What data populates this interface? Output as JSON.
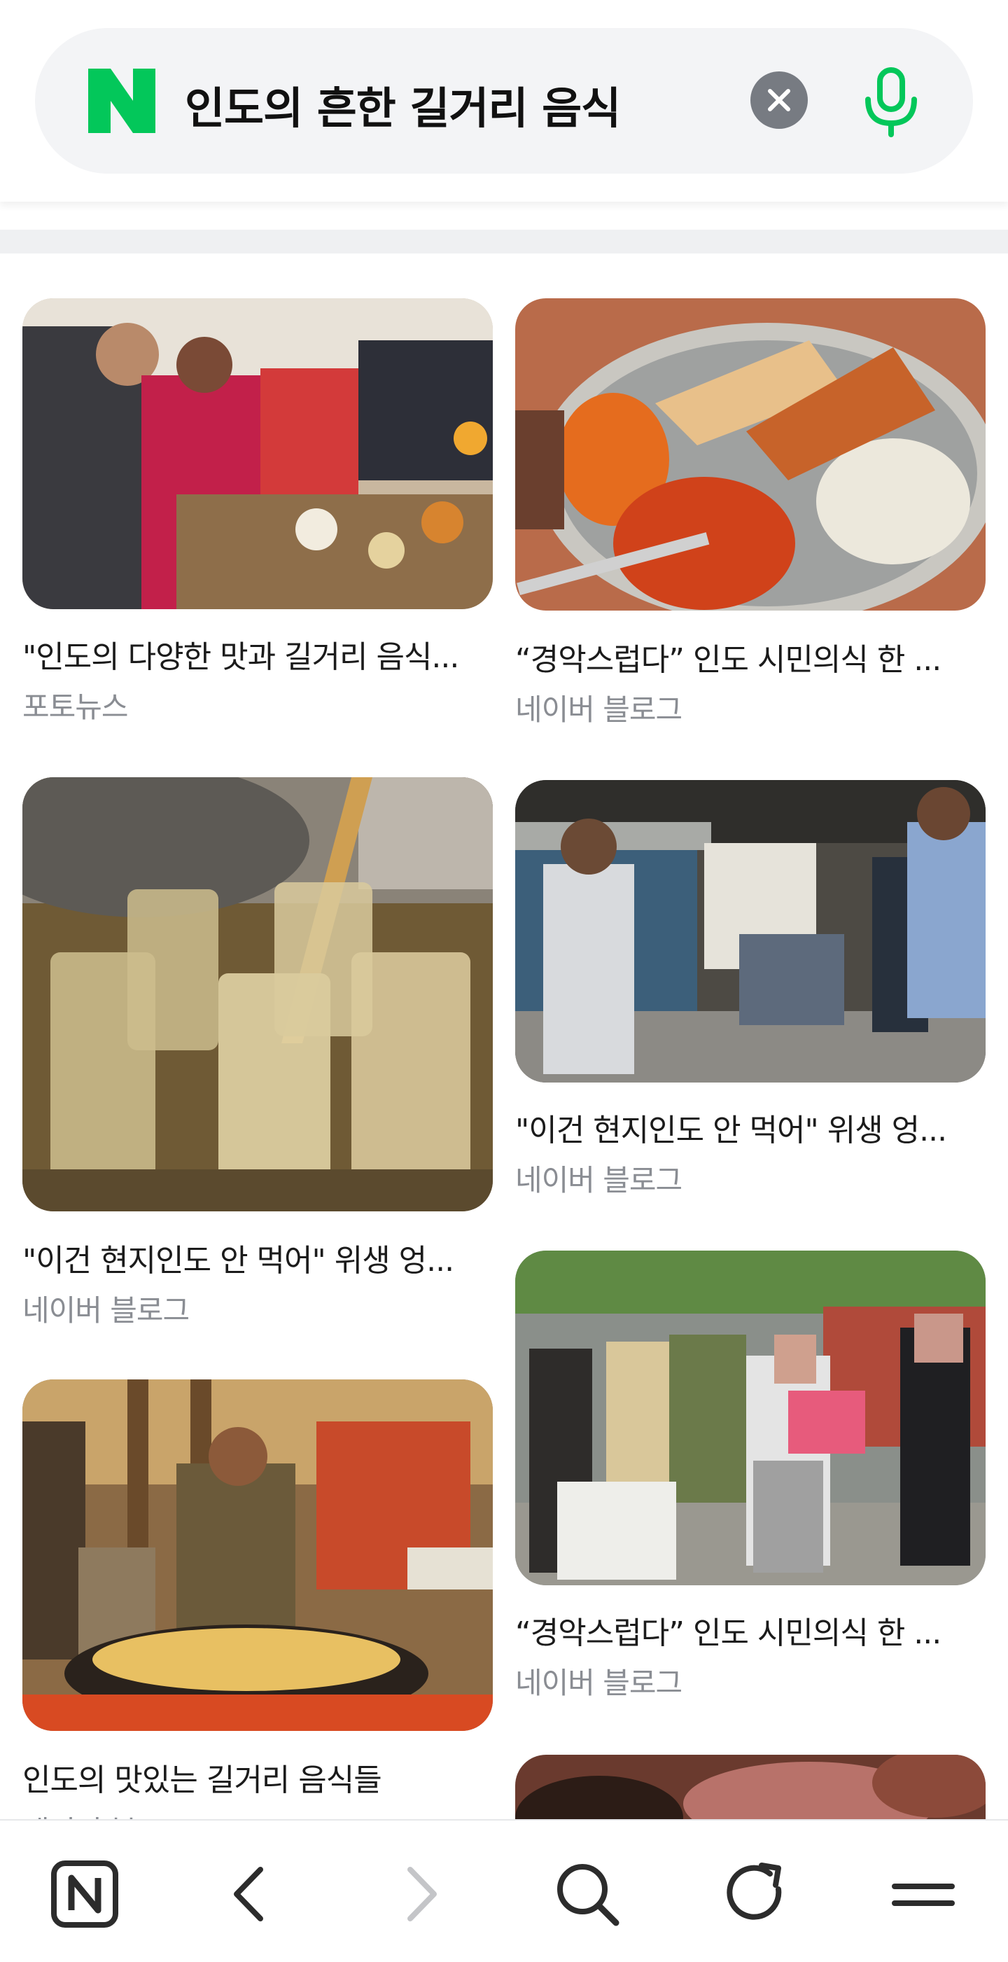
{
  "search": {
    "query": "인도의 흔한 길거리 음식",
    "logo_letter": "N",
    "brand_color": "#03c75a",
    "clear_icon": "close-icon",
    "voice_icon": "microphone-icon"
  },
  "results": [
    {
      "title": "\"인도의 다양한 맛과 길거리 음식...",
      "source": "포토뉴스"
    },
    {
      "title": "“경악스럽다” 인도 시민의식 한 ...",
      "source": "네이버 블로그"
    },
    {
      "title": "\"이건 현지인도 안 먹어\" 위생 엉...",
      "source": "네이버 블로그"
    },
    {
      "title": "\"이건 현지인도 안 먹어\" 위생 엉...",
      "source": "네이버 블로그"
    },
    {
      "title": "“경악스럽다” 인도 시민의식 한 ...",
      "source": "네이버 블로그"
    },
    {
      "title": "인도의 맛있는 길거리 음식들",
      "source": "네이버 블로그"
    }
  ],
  "nav": {
    "home_icon": "naver-home-icon",
    "back_icon": "back-arrow-icon",
    "forward_icon": "forward-arrow-icon",
    "search_icon": "search-icon",
    "refresh_icon": "refresh-icon",
    "menu_icon": "menu-icon"
  }
}
